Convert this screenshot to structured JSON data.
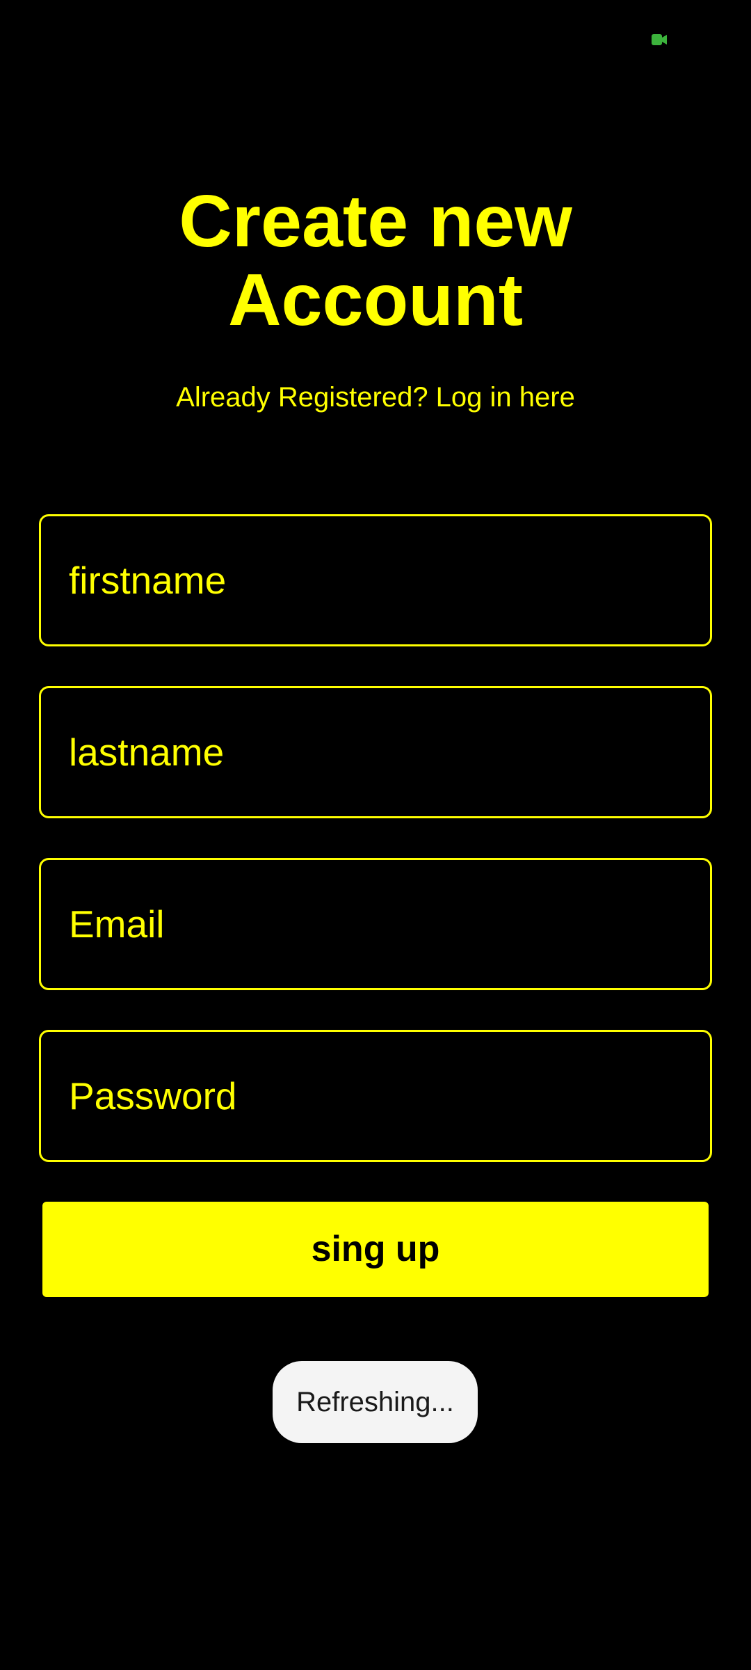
{
  "status_bar": {
    "icon": "camera-recording-icon",
    "icon_color": "#3CB33C"
  },
  "title": {
    "line1": "Create new",
    "line2": "Account"
  },
  "login_link": "Already Registered? Log in here",
  "form": {
    "firstname_placeholder": "firstname",
    "lastname_placeholder": "lastname",
    "email_placeholder": "Email",
    "password_placeholder": "Password",
    "signup_label": "sing up"
  },
  "toast": "Refreshing...",
  "colors": {
    "background": "#000000",
    "accent": "#FFFF00",
    "toast_background": "#F4F4F4"
  }
}
